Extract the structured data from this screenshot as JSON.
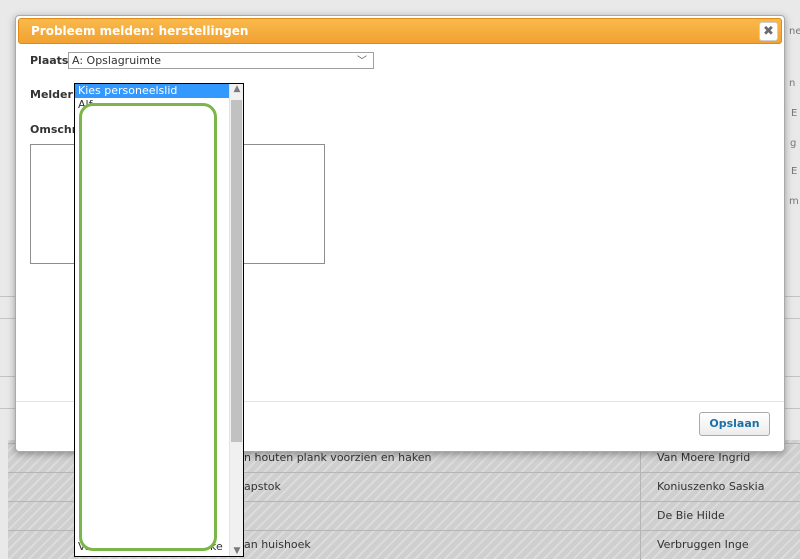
{
  "dialog": {
    "title": "Probleem melden: herstellingen",
    "close_label": "✖",
    "plaats_label": "Plaats:",
    "plaats_value": "A: Opslagruimte",
    "melder_label": "Melder:",
    "omschrijving_label": "Omschr",
    "save_label": "Opslaan"
  },
  "dropdown": {
    "selected": "Kies personeelslid",
    "second": "Alf",
    "last": "Va",
    "last_tail": "ke"
  },
  "background": {
    "rows": [
      {
        "description": "n houten plank voorzien en haken",
        "person": "Van Moere Ingrid"
      },
      {
        "description": "apstok",
        "person": "Koniuszenko Saskia"
      },
      {
        "description": "",
        "person": "De Bie Hilde"
      },
      {
        "description": "an huishoek",
        "person": "Verbruggen Inge"
      }
    ],
    "right_fragments": [
      "ne",
      "n",
      "E",
      "g",
      "E",
      "m"
    ]
  },
  "colors": {
    "titlebar": "#f2a232",
    "selected_option": "#3399ff",
    "highlight": "#7ab648",
    "save_text": "#1d6fa5"
  }
}
